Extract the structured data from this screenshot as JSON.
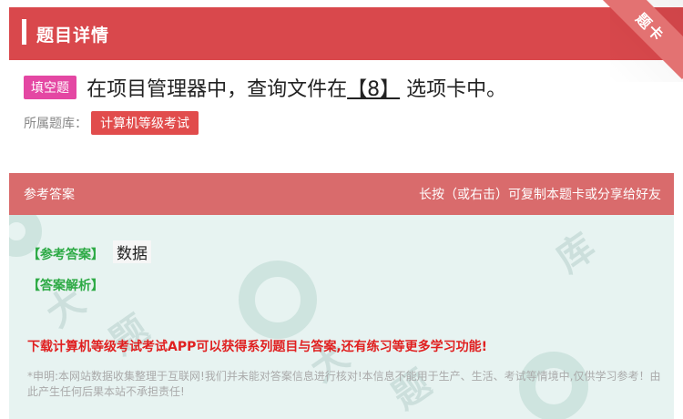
{
  "header": {
    "title": "题目详情",
    "corner_label": "题卡"
  },
  "question": {
    "type_badge": "填空题",
    "text_before": "在项目管理器中，查询文件在",
    "blank": "【8】",
    "text_after": "选项卡中。",
    "bank_label": "所属题库：",
    "bank_tag": "计算机等级考试"
  },
  "answer_header": {
    "left": "参考答案",
    "right": "长按（或右击）可复制本题卡或分享给好友"
  },
  "answer": {
    "ref_label": "【参考答案】",
    "ref_value": "数据",
    "analysis_label": "【答案解析】",
    "promo": "下载计算机等级考试考试APP可以获得系列题目与答案,还有练习等更多学习功能!",
    "disclaimer": "*申明:本网站数据收集整理于互联网!我们并未能对答案信息进行核对!本信息不能用于生产、生活、考试等情境中,仅供学习参考！由此产生任何后果本站不承担责任!"
  },
  "colors": {
    "header_bg": "#d9484c",
    "badge_pink": "#e447a3",
    "tag_red": "#e14c4c",
    "answer_header_bg": "#d96b6c",
    "answer_bg": "#e7f3f1",
    "green": "#2daa45",
    "promo_red": "#e02020"
  }
}
